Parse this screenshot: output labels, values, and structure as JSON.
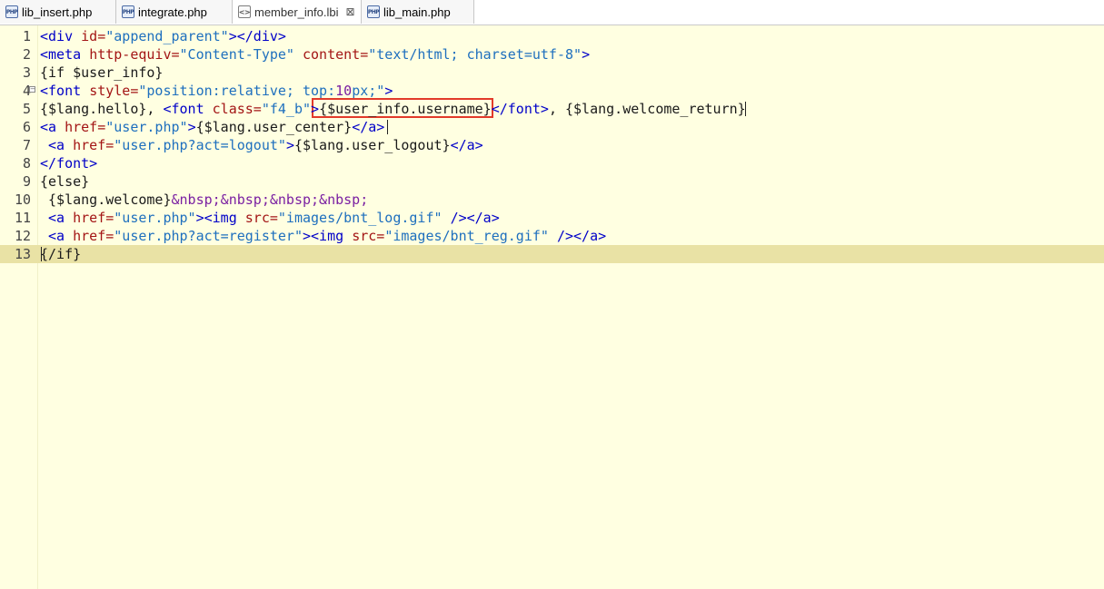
{
  "tabs": [
    {
      "label": "lib_insert.php",
      "icon": "php-file-icon",
      "active": false
    },
    {
      "label": "integrate.php",
      "icon": "php-file-icon",
      "active": false
    },
    {
      "label": "member_info.lbi",
      "icon": "lbi-file-icon",
      "active": true,
      "close": "⊠"
    },
    {
      "label": "lib_main.php",
      "icon": "php-file-icon",
      "active": false
    }
  ],
  "icons": {
    "php_badge": "PHP",
    "lbi_badge": "<>"
  },
  "editor": {
    "fold_marker": "−",
    "current_line": 13,
    "lines": [
      {
        "n": "1",
        "tokens": [
          [
            "tg",
            "<div "
          ],
          [
            "at",
            "id="
          ],
          [
            "st",
            "\"append_parent\""
          ],
          [
            "tg",
            "></div>"
          ]
        ]
      },
      {
        "n": "2",
        "tokens": [
          [
            "tg",
            "<meta "
          ],
          [
            "at",
            "http-equiv="
          ],
          [
            "st",
            "\"Content-Type\""
          ],
          [
            "tx",
            " "
          ],
          [
            "at",
            "content="
          ],
          [
            "st",
            "\"text/html; charset=utf-8\""
          ],
          [
            "tg",
            ">"
          ]
        ]
      },
      {
        "n": "3",
        "tokens": [
          [
            "tx",
            "{if $user_info}"
          ]
        ]
      },
      {
        "n": "4",
        "tokens": [
          [
            "tg",
            "<font "
          ],
          [
            "at",
            "style="
          ],
          [
            "st",
            "\"position:relative; top:"
          ],
          [
            "nm",
            "10"
          ],
          [
            "st",
            "px;\""
          ],
          [
            "tg",
            ">"
          ]
        ]
      },
      {
        "n": "5",
        "tokens": [
          [
            "tx",
            "{$lang.hello}, "
          ],
          [
            "tg",
            "<font "
          ],
          [
            "at",
            "class="
          ],
          [
            "st",
            "\"f4_b\""
          ],
          [
            "tg",
            ">"
          ],
          [
            "tx",
            "{$user_info.username}"
          ],
          [
            "tg",
            "</font>"
          ],
          [
            "tx",
            ", {$lang.welcome_return}"
          ]
        ]
      },
      {
        "n": "6",
        "tokens": [
          [
            "tg",
            "<a "
          ],
          [
            "at",
            "href="
          ],
          [
            "st",
            "\"user.php\""
          ],
          [
            "tg",
            ">"
          ],
          [
            "tx",
            "{$lang.user_center}"
          ],
          [
            "tg",
            "</a>"
          ]
        ]
      },
      {
        "n": "7",
        "tokens": [
          [
            "tx",
            " "
          ],
          [
            "tg",
            "<a "
          ],
          [
            "at",
            "href="
          ],
          [
            "st",
            "\"user.php?act=logout\""
          ],
          [
            "tg",
            ">"
          ],
          [
            "tx",
            "{$lang.user_logout}"
          ],
          [
            "tg",
            "</a>"
          ]
        ]
      },
      {
        "n": "8",
        "tokens": [
          [
            "tg",
            "</font>"
          ]
        ]
      },
      {
        "n": "9",
        "tokens": [
          [
            "tx",
            "{else}"
          ]
        ]
      },
      {
        "n": "10",
        "tokens": [
          [
            "tx",
            " {$lang.welcome}"
          ],
          [
            "nm",
            "&nbsp;&nbsp;&nbsp;&nbsp;"
          ]
        ]
      },
      {
        "n": "11",
        "tokens": [
          [
            "tx",
            " "
          ],
          [
            "tg",
            "<a "
          ],
          [
            "at",
            "href="
          ],
          [
            "st",
            "\"user.php\""
          ],
          [
            "tg",
            "><img "
          ],
          [
            "at",
            "src="
          ],
          [
            "st",
            "\"images/bnt_log.gif\""
          ],
          [
            "tx",
            " "
          ],
          [
            "tg",
            "/></a>"
          ]
        ]
      },
      {
        "n": "12",
        "tokens": [
          [
            "tx",
            " "
          ],
          [
            "tg",
            "<a "
          ],
          [
            "at",
            "href="
          ],
          [
            "st",
            "\"user.php?act=register\""
          ],
          [
            "tg",
            "><img "
          ],
          [
            "at",
            "src="
          ],
          [
            "st",
            "\"images/bnt_reg.gif\""
          ],
          [
            "tx",
            " "
          ],
          [
            "tg",
            "/></a>"
          ]
        ]
      },
      {
        "n": "13",
        "tokens": [
          [
            "tx",
            "{/if}"
          ]
        ]
      }
    ]
  },
  "colors": {
    "highlight_box": "#e23a2a",
    "editor_bg": "#ffffe1",
    "current_line": "#e9e2a5"
  }
}
